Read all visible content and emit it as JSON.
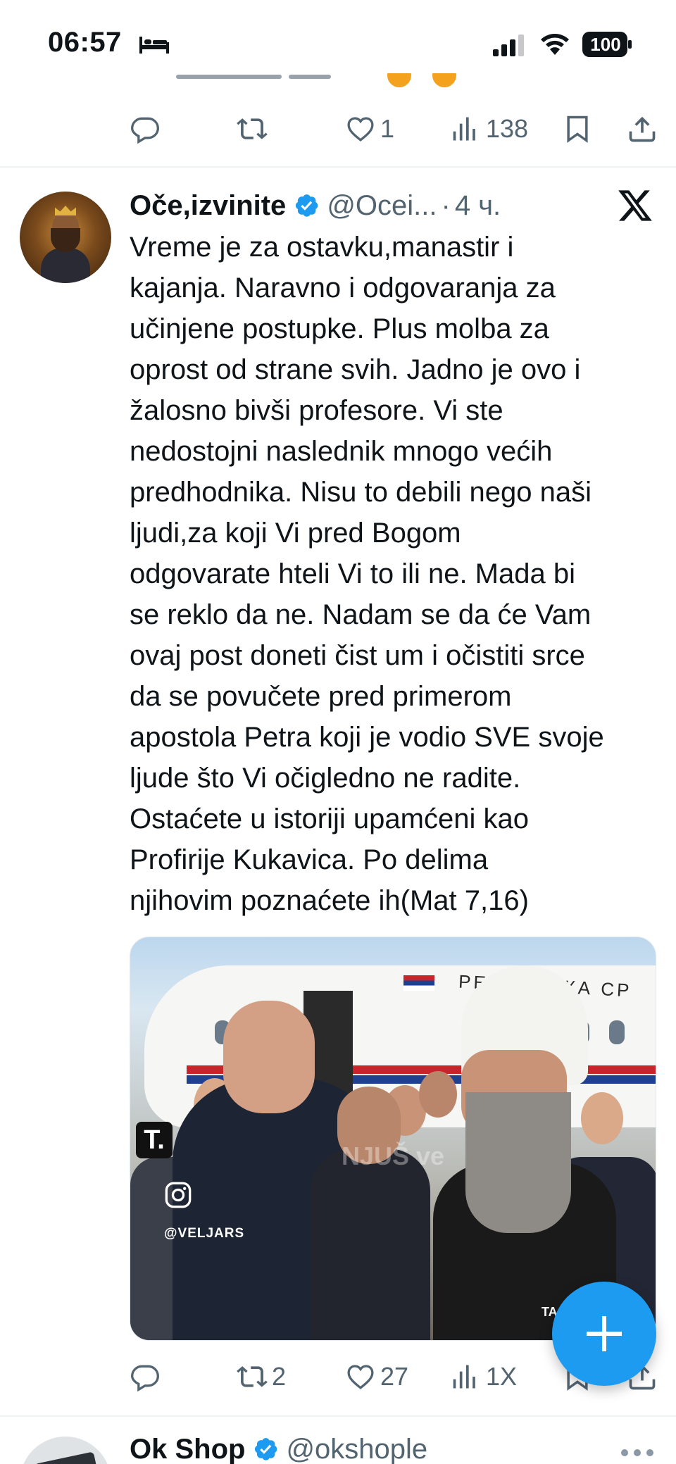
{
  "status_bar": {
    "time": "06:57",
    "battery": "100",
    "icons": [
      "bed-icon",
      "signal-icon",
      "wifi-icon",
      "battery-icon"
    ]
  },
  "prev_tweet": {
    "actions": {
      "reply": "",
      "retweet": "",
      "like": "1",
      "views": "138"
    }
  },
  "tweet": {
    "display_name": "Oče,izvinite",
    "handle": "@Ocei...",
    "separator": "·",
    "time": "4 ч.",
    "text": "Vreme je za ostavku,manastir i\nkajanja. Naravno i odgovaranja za\nučinjene postupke. Plus molba za\noprost od strane svih. Jadno je ovo i\nžalosno bivši profesore. Vi ste\nnedostojni naslednik mnogo većih\npredhodnika. Nisu to debili nego naši\nljudi,za koji Vi pred Bogom\nodgovarate hteli Vi to ili ne. Mada bi\nse reklo da ne. Nadam se da će Vam\novaj post doneti čist um i očistiti srce\nda se povučete pred primerom\napostola Petra koji je vodio SVE svoje\nljude što Vi očigledno ne radite.\nOstaćete u istoriji upamćeni kao\nProfirije Kukavica. Po delima\nnjihovim poznaćete ih(Mat 7,16)",
    "media": {
      "plane_text": "РЕПУБЛИКА СР",
      "watermark_logo": "T.",
      "watermark_handle": "@VELJARS",
      "watermark_center": "NJUŠ ve",
      "watermark_corner": "TA"
    },
    "actions": {
      "reply": "",
      "retweet": "2",
      "like": "27",
      "views": "1X"
    }
  },
  "next_tweet": {
    "display_name": "Ok Shop",
    "handle": "@okshople"
  },
  "colors": {
    "accent": "#1d9bf0",
    "text": "#0f1419",
    "secondary": "#536471"
  }
}
